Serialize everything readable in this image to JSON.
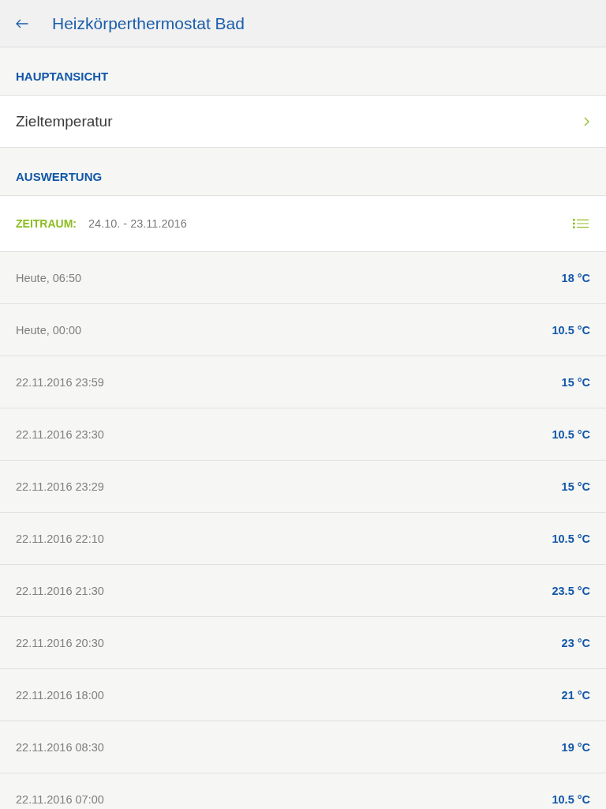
{
  "header": {
    "title": "Heizkörperthermostat Bad"
  },
  "main_view": {
    "heading": "HAUPTANSICHT",
    "items": [
      {
        "label": "Zieltemperatur"
      }
    ]
  },
  "evaluation": {
    "heading": "AUSWERTUNG",
    "period": {
      "label": "ZEITRAUM:",
      "value": "24.10. - 23.11.2016"
    },
    "readings": [
      {
        "time": "Heute, 06:50",
        "temperature": "18 °C"
      },
      {
        "time": "Heute, 00:00",
        "temperature": "10.5 °C"
      },
      {
        "time": "22.11.2016 23:59",
        "temperature": "15 °C"
      },
      {
        "time": "22.11.2016 23:30",
        "temperature": "10.5 °C"
      },
      {
        "time": "22.11.2016 23:29",
        "temperature": "15 °C"
      },
      {
        "time": "22.11.2016 22:10",
        "temperature": "10.5 °C"
      },
      {
        "time": "22.11.2016 21:30",
        "temperature": "23.5 °C"
      },
      {
        "time": "22.11.2016 20:30",
        "temperature": "23 °C"
      },
      {
        "time": "22.11.2016 18:00",
        "temperature": "21 °C"
      },
      {
        "time": "22.11.2016 08:30",
        "temperature": "19 °C"
      },
      {
        "time": "22.11.2016 07:00",
        "temperature": "10.5 °C"
      }
    ]
  }
}
